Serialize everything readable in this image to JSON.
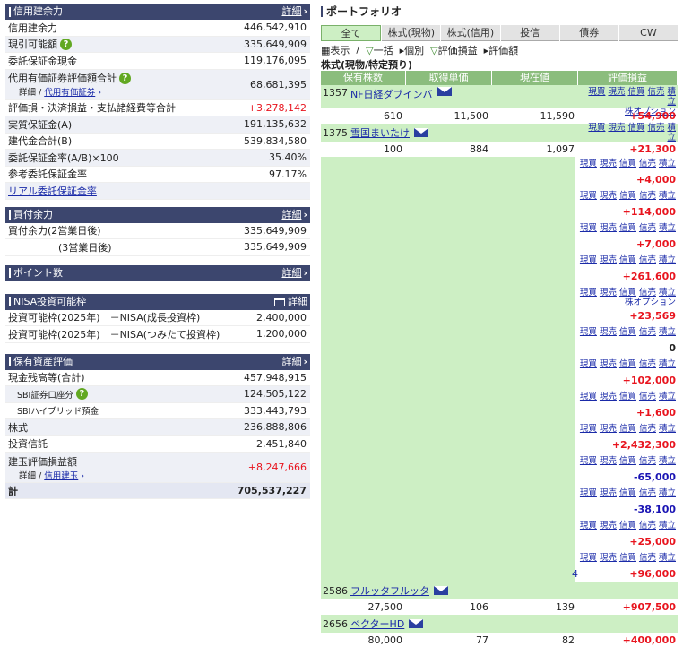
{
  "shinyo": {
    "title": "信用建余力",
    "detail": "詳細",
    "rows": [
      {
        "label": "信用建余力",
        "value": "446,542,910"
      },
      {
        "label": "現引可能額",
        "value": "335,649,909"
      },
      {
        "label": "委託保証金現金",
        "value": "119,176,095"
      },
      {
        "label": "代用有価証券評価額合計",
        "value": "68,681,395",
        "sub_prefix": "詳細 / ",
        "sub_link": "代用有価証券"
      },
      {
        "label": "評価損・決済損益・支払諸経費等合計",
        "value": "+3,278,142"
      },
      {
        "label": "実質保証金(A)",
        "value": "191,135,632"
      },
      {
        "label": "建代金合計(B)",
        "value": "539,834,580"
      },
      {
        "label": "委託保証金率(A/B)×100",
        "value": "35.40%"
      },
      {
        "label": "参考委託保証金率",
        "value": "97.17%"
      }
    ],
    "real_link": "リアル委託保証金率"
  },
  "kaitsuke": {
    "title": "買付余力",
    "detail": "詳細",
    "rows": [
      {
        "label": "買付余力(2営業日後)",
        "value": "335,649,909"
      },
      {
        "label": "(3営業日後)",
        "value": "335,649,909"
      }
    ]
  },
  "points": {
    "title": "ポイント数",
    "detail": "詳細"
  },
  "nisa": {
    "title": "NISA投資可能枠",
    "detail": "詳細",
    "rows": [
      {
        "label": "投資可能枠(2025年)　－NISA(成長投資枠)",
        "value": "2,400,000"
      },
      {
        "label": "投資可能枠(2025年)　－NISA(つみたて投資枠)",
        "value": "1,200,000"
      }
    ]
  },
  "assets": {
    "title": "保有資産評価",
    "detail": "詳細",
    "rows": [
      {
        "label": "現金残高等(合計)",
        "value": "457,948,915"
      },
      {
        "label": "SBI証券口座分",
        "value": "124,505,122"
      },
      {
        "label": "SBIハイブリッド預金",
        "value": "333,443,793"
      },
      {
        "label": "株式",
        "value": "236,888,806"
      },
      {
        "label": "投資信託",
        "value": "2,451,840"
      },
      {
        "label": "建玉評価損益額",
        "value": "+8,247,666",
        "sub_prefix": "詳細 / ",
        "sub_link": "信用建玉"
      }
    ],
    "total_label": "計",
    "total_value": "705,537,227"
  },
  "portfolio": {
    "title": "ポートフォリオ",
    "tabs": [
      "全て",
      "株式(現物)",
      "株式(信用)",
      "投信",
      "債券",
      "CW"
    ],
    "toolbar": [
      "表示",
      "一括",
      "個別",
      "評価損益",
      "評価額"
    ],
    "subtitle": "株式(現物/特定預り)",
    "headers": [
      "保有株数",
      "取得単価",
      "現在値",
      "評価損益"
    ],
    "actions": [
      "現買",
      "現売",
      "信買",
      "信売",
      "積立"
    ],
    "option_label": "株オプション",
    "holdings": [
      {
        "code": "1357",
        "name": "NF日経ダブインバ",
        "qty": "610",
        "cost": "11,500",
        "price": "11,590",
        "pl": "+54,900"
      },
      {
        "code": "1375",
        "name": "雪国まいたけ",
        "qty": "100",
        "cost": "884",
        "price": "1,097",
        "pl": "+21,300"
      }
    ],
    "masked_pl": [
      "+4,000",
      "+114,000",
      "+7,000",
      "+261,600",
      "+23,569",
      "0",
      "+102,000",
      "+1,600",
      "+2,432,300",
      "-65,000",
      "-38,100",
      "+25,000",
      "+96,000"
    ],
    "masked_fragment": "4",
    "bottom_holdings": [
      {
        "code": "2586",
        "name": "フルッタフルッタ",
        "qty": "27,500",
        "cost": "106",
        "price": "139",
        "pl": "+907,500"
      },
      {
        "code": "2656",
        "name": "ベクターHD",
        "qty": "80,000",
        "cost": "77",
        "price": "82",
        "pl": "+400,000"
      }
    ]
  }
}
